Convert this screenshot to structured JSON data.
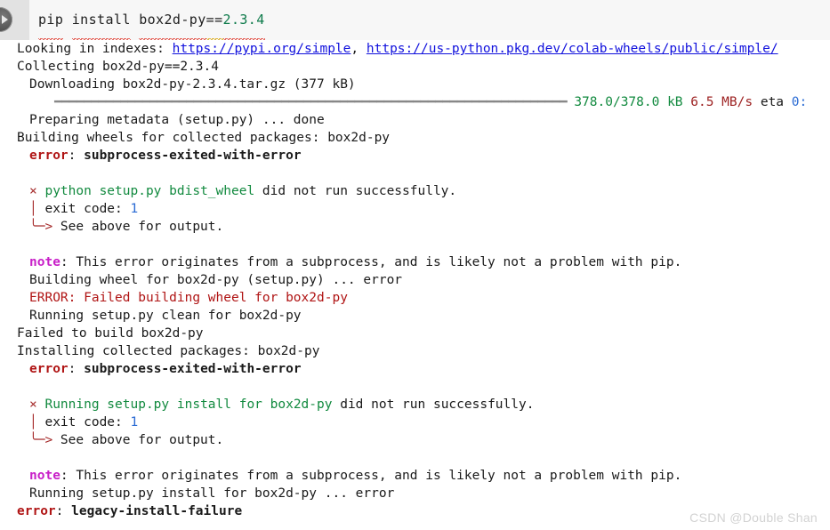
{
  "cell": {
    "run_button_label": "run-cell",
    "command_tokens": [
      {
        "text": "pip",
        "color": "dark",
        "squiggle": "red"
      },
      {
        "text": " ",
        "color": "dark",
        "squiggle": "none"
      },
      {
        "text": "install",
        "color": "dark",
        "squiggle": "red"
      },
      {
        "text": " ",
        "color": "dark",
        "squiggle": "none"
      },
      {
        "text": "box2d-py",
        "color": "dark",
        "squiggle": "red"
      },
      {
        "text": "==",
        "color": "dark",
        "squiggle": "yellow"
      },
      {
        "text": "2.3.4",
        "color": "green",
        "squiggle": "red"
      }
    ],
    "command_plain": "pip install box2d-py==2.3.4"
  },
  "output": {
    "lines": [
      {
        "id": "line-looking-in-indexes",
        "indent": 0,
        "parts": [
          {
            "t": "Looking in indexes: ",
            "c": "black"
          },
          {
            "t": "https://pypi.org/simple",
            "c": "link"
          },
          {
            "t": ", ",
            "c": "black"
          },
          {
            "t": "https://us-python.pkg.dev/colab-wheels/public/simple/",
            "c": "link"
          }
        ]
      },
      {
        "id": "line-collecting",
        "indent": 0,
        "parts": [
          {
            "t": "Collecting box2d-py==2.3.4",
            "c": "black"
          }
        ]
      },
      {
        "id": "line-downloading",
        "indent": 1,
        "parts": [
          {
            "t": "Downloading box2d-py-2.3.4.tar.gz (377 kB)",
            "c": "black"
          }
        ]
      },
      {
        "id": "line-progress-bar",
        "indent": 3,
        "parts": [
          {
            "t": "━━━━━━━━━━━━━━━━━━━━━━━━━━━━━━━━━━━━━━━━━━━━━━━━━━━━━━━━━━━━━━━━━━━━━━ ",
            "c": "bar"
          },
          {
            "t": "378.0/378.0 kB",
            "c": "green"
          },
          {
            "t": " ",
            "c": "black"
          },
          {
            "t": "6.5 MB/s",
            "c": "darkred"
          },
          {
            "t": " eta ",
            "c": "black"
          },
          {
            "t": "0:",
            "c": "blue"
          }
        ]
      },
      {
        "id": "line-preparing-metadata",
        "indent": 1,
        "parts": [
          {
            "t": "Preparing metadata (setup.py) ... done",
            "c": "black"
          }
        ]
      },
      {
        "id": "line-building-wheels",
        "indent": 0,
        "parts": [
          {
            "t": "Building wheels for collected packages: box2d-py",
            "c": "black"
          }
        ]
      },
      {
        "id": "line-error-subprocess-1",
        "indent": 1,
        "parts": [
          {
            "t": "error",
            "c": "red",
            "b": true
          },
          {
            "t": ": ",
            "c": "black"
          },
          {
            "t": "subprocess-exited-with-error",
            "c": "black",
            "b": true
          }
        ]
      },
      {
        "id": "line-blank-1",
        "indent": 0,
        "parts": []
      },
      {
        "id": "line-x-bdist-wheel",
        "indent": 1,
        "parts": [
          {
            "t": "× ",
            "c": "crimson"
          },
          {
            "t": "python setup.py bdist_wheel",
            "c": "green"
          },
          {
            "t": " did not run successfully.",
            "c": "black"
          }
        ]
      },
      {
        "id": "line-exit-code-1",
        "indent": 1,
        "parts": [
          {
            "t": "│ ",
            "c": "crimson"
          },
          {
            "t": "exit code: ",
            "c": "black"
          },
          {
            "t": "1",
            "c": "blue"
          }
        ]
      },
      {
        "id": "line-see-above-1",
        "indent": 1,
        "parts": [
          {
            "t": "╰─> ",
            "c": "crimson"
          },
          {
            "t": "See above for output.",
            "c": "black"
          }
        ]
      },
      {
        "id": "line-blank-2",
        "indent": 0,
        "parts": []
      },
      {
        "id": "line-note-1",
        "indent": 1,
        "parts": [
          {
            "t": "note",
            "c": "magenta",
            "b": true
          },
          {
            "t": ": This error originates from a subprocess, and is likely not a problem with pip.",
            "c": "black"
          }
        ]
      },
      {
        "id": "line-building-wheel-setuppy",
        "indent": 1,
        "parts": [
          {
            "t": "Building wheel for box2d-py (setup.py) ... error",
            "c": "black"
          }
        ]
      },
      {
        "id": "line-error-failed-building",
        "indent": 1,
        "parts": [
          {
            "t": "ERROR: Failed building wheel for box2d-py",
            "c": "red"
          }
        ]
      },
      {
        "id": "line-running-clean",
        "indent": 1,
        "parts": [
          {
            "t": "Running setup.py clean for box2d-py",
            "c": "black"
          }
        ]
      },
      {
        "id": "line-failed-to-build",
        "indent": 0,
        "parts": [
          {
            "t": "Failed to build box2d-py",
            "c": "black"
          }
        ]
      },
      {
        "id": "line-installing-collected",
        "indent": 0,
        "parts": [
          {
            "t": "Installing collected packages: box2d-py",
            "c": "black"
          }
        ]
      },
      {
        "id": "line-error-subprocess-2",
        "indent": 1,
        "parts": [
          {
            "t": "error",
            "c": "red",
            "b": true
          },
          {
            "t": ": ",
            "c": "black"
          },
          {
            "t": "subprocess-exited-with-error",
            "c": "black",
            "b": true
          }
        ]
      },
      {
        "id": "line-blank-3",
        "indent": 0,
        "parts": []
      },
      {
        "id": "line-x-install",
        "indent": 1,
        "parts": [
          {
            "t": "× ",
            "c": "crimson"
          },
          {
            "t": "Running setup.py install for box2d-py",
            "c": "green"
          },
          {
            "t": " did not run successfully.",
            "c": "black"
          }
        ]
      },
      {
        "id": "line-exit-code-2",
        "indent": 1,
        "parts": [
          {
            "t": "│ ",
            "c": "crimson"
          },
          {
            "t": "exit code: ",
            "c": "black"
          },
          {
            "t": "1",
            "c": "blue"
          }
        ]
      },
      {
        "id": "line-see-above-2",
        "indent": 1,
        "parts": [
          {
            "t": "╰─> ",
            "c": "crimson"
          },
          {
            "t": "See above for output.",
            "c": "black"
          }
        ]
      },
      {
        "id": "line-blank-4",
        "indent": 0,
        "parts": []
      },
      {
        "id": "line-note-2",
        "indent": 1,
        "parts": [
          {
            "t": "note",
            "c": "magenta",
            "b": true
          },
          {
            "t": ": This error originates from a subprocess, and is likely not a problem with pip.",
            "c": "black"
          }
        ]
      },
      {
        "id": "line-running-install-error",
        "indent": 1,
        "parts": [
          {
            "t": "Running setup.py install for box2d-py ... error",
            "c": "black"
          }
        ]
      },
      {
        "id": "line-error-legacy-install",
        "indent": 0,
        "parts": [
          {
            "t": "error",
            "c": "red",
            "b": true
          },
          {
            "t": ": ",
            "c": "black"
          },
          {
            "t": "legacy-install-failure",
            "c": "black",
            "b": true
          }
        ]
      }
    ]
  },
  "watermark": {
    "text": "CSDN @Double Shan"
  },
  "colors": {
    "link": "#1111dd",
    "green": "#128a3f",
    "red": "#b01515",
    "magenta": "#c820c8",
    "blue": "#2a6bd4",
    "bar": "#888888",
    "cell_background": "#f7f7f7",
    "gutter": "#e2e2e2"
  }
}
